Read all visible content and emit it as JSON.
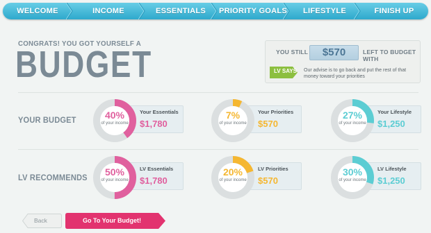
{
  "nav": {
    "items": [
      {
        "label": "WELCOME"
      },
      {
        "label": "INCOME"
      },
      {
        "label": "ESSENTIALS"
      },
      {
        "label": "PRIORITY GOALS"
      },
      {
        "label": "LIFESTYLE"
      },
      {
        "label": "FINISH UP"
      }
    ]
  },
  "header": {
    "congrats": "CONGRATS! YOU GOT YOURSELF A",
    "title": "BUDGET"
  },
  "remaining": {
    "prefix": "YOU STILL HAVE",
    "amount": "$570",
    "suffix": "LEFT TO BUDGET WITH",
    "lv_says_label": "LV SAYS",
    "advice": "Our advise is to go back and put the rest of that money toward your priorities"
  },
  "rows": {
    "your_budget_label": "YOUR BUDGET",
    "lv_recommends_label": "LV RECOMMENDS"
  },
  "cards": {
    "your_essentials": {
      "percent_label": "40%",
      "percent": 40,
      "of_text": "of your income",
      "category": "Your Essentials",
      "amount": "$1,780",
      "color": "#e0609e"
    },
    "your_priorities": {
      "percent_label": "7%",
      "percent": 7,
      "of_text": "of your income",
      "category": "Your Priorities",
      "amount": "$570",
      "color": "#f5b731"
    },
    "your_lifestyle": {
      "percent_label": "27%",
      "percent": 27,
      "of_text": "of your income",
      "category": "Your Lifestyle",
      "amount": "$1,250",
      "color": "#5ccdd3"
    },
    "lv_essentials": {
      "percent_label": "50%",
      "percent": 50,
      "of_text": "of your income",
      "category": "LV Essentials",
      "amount": "$1,780",
      "color": "#e0609e"
    },
    "lv_priorities": {
      "percent_label": "20%",
      "percent": 20,
      "of_text": "of your income",
      "category": "LV Priorities",
      "amount": "$570",
      "color": "#f5b731"
    },
    "lv_lifestyle": {
      "percent_label": "30%",
      "percent": 30,
      "of_text": "of your income",
      "category": "LV Lifestyle",
      "amount": "$1,250",
      "color": "#5ccdd3"
    }
  },
  "buttons": {
    "back": "Back",
    "go": "Go To Your Budget!"
  },
  "colors": {
    "nav": "#3bb3d6",
    "pink": "#e0609e",
    "yellow": "#f5b731",
    "teal": "#5ccdd3",
    "ring_track": "#dbdfe0",
    "go_button": "#e2336f",
    "lv_green": "#8cbf3f"
  }
}
